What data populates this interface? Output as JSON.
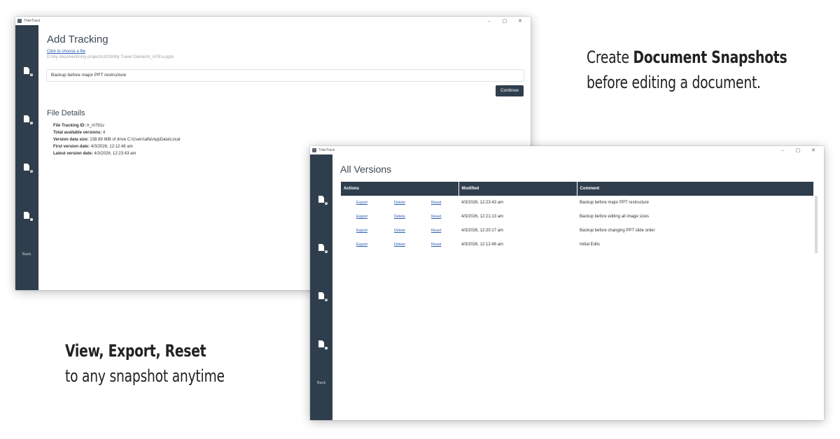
{
  "captions": {
    "top_prefix": "Create ",
    "top_bold": "Document Snapshots",
    "top_line2": "before editing a document.",
    "bottom_bold": "View, Export, Reset",
    "bottom_line2": "to any snapshot anytime"
  },
  "window1": {
    "title": "TrikeTrack",
    "controls": [
      "–",
      "▢",
      "✕"
    ],
    "sidebar_icons": [
      "add-doc-icon",
      "info-doc-icon",
      "settings-doc-icon",
      "check-doc-icon"
    ],
    "back_label": "Back",
    "heading": "Add Tracking",
    "choose_file_link": "Click to choose a file",
    "file_path": "D:\\my documents\\my projects\\2026\\My Travel Diaries\\tr_m761v.pptx",
    "comment_value": "Backup before major PPT restructure",
    "continue_label": "Continue",
    "details_heading": "File Details",
    "details": [
      {
        "label": "File Tracking ID:",
        "value": "tr_m761v"
      },
      {
        "label": "Total available versions:",
        "value": "4"
      },
      {
        "label": "Version data size:",
        "value": "238.89 MiB of drive C:\\Users\\alfa\\AppData\\Local"
      },
      {
        "label": "First version date:",
        "value": "4/3/2026, 12:12:46 am"
      },
      {
        "label": "Latest version date:",
        "value": "4/3/2026, 12:23:43 am"
      }
    ]
  },
  "window2": {
    "title": "TrikeTrack",
    "controls": [
      "–",
      "▢",
      "✕"
    ],
    "back_label": "Back",
    "heading": "All Versions",
    "columns": [
      "Actions",
      "Modified",
      "Comment"
    ],
    "action_labels": {
      "export": "Export",
      "delete": "Delete",
      "reset": "Reset"
    },
    "rows": [
      {
        "modified": "4/3/2026, 12:23:43 am",
        "comment": "Backup before major PPT restructure"
      },
      {
        "modified": "4/3/2026, 12:21:13 am",
        "comment": "Backup before editing all image sizes"
      },
      {
        "modified": "4/3/2026, 12:20:17 am",
        "comment": "Backup before changing PPT slide order"
      },
      {
        "modified": "4/3/2026, 12:12:46 am",
        "comment": "Initial Edits"
      }
    ]
  },
  "colors": {
    "sidebar": "#2f3e4d",
    "link": "#2a5bb0",
    "accent_button": "#2f3e4d"
  }
}
